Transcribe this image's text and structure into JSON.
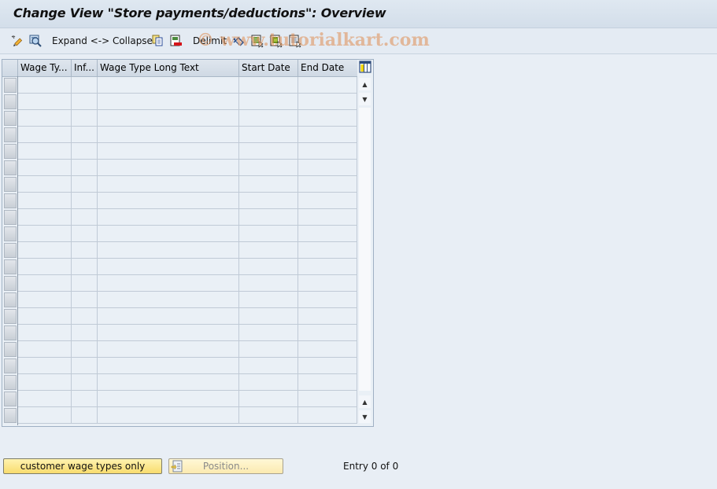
{
  "window": {
    "title": "Change View \"Store payments/deductions\": Overview"
  },
  "toolbar": {
    "items": [
      {
        "type": "icon",
        "icon": "change-display-icon"
      },
      {
        "type": "icon",
        "icon": "details-icon"
      },
      {
        "type": "text",
        "label": "Expand <-> Collapse"
      },
      {
        "type": "icon",
        "icon": "copy-icon"
      },
      {
        "type": "icon",
        "icon": "delete-icon"
      },
      {
        "type": "text",
        "label": "Delimit"
      },
      {
        "type": "icon",
        "icon": "undo-change-icon"
      },
      {
        "type": "icon",
        "icon": "select-all-icon"
      },
      {
        "type": "icon",
        "icon": "select-block-icon"
      },
      {
        "type": "icon",
        "icon": "deselect-all-icon"
      }
    ],
    "expand_collapse_label": "Expand <-> Collapse",
    "delimit_label": "Delimit"
  },
  "watermark": "© www.tutorialkart.com",
  "table": {
    "columns": [
      "Wage Ty...",
      "Inf...",
      "Wage Type Long Text",
      "Start Date",
      "End Date"
    ],
    "rows": [],
    "visible_empty_rows": 21,
    "column_settings_icon": "column-settings-icon"
  },
  "footer": {
    "customer_button_label": "customer wage types only",
    "position_button_label": "Position...",
    "entry_text": "Entry 0 of 0"
  },
  "colors": {
    "background": "#e8eef5",
    "primary_button": "#f8dc6e",
    "grid_line": "#c0cad6"
  }
}
